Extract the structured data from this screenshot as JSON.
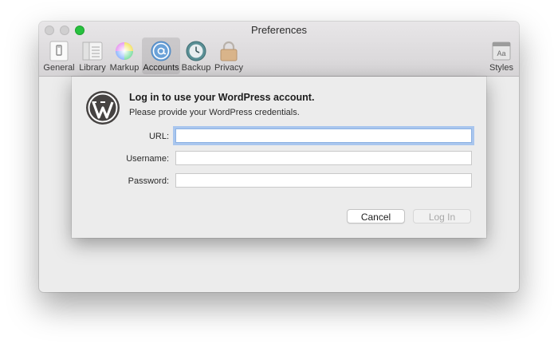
{
  "window": {
    "title": "Preferences"
  },
  "toolbar": {
    "items": [
      {
        "label": "General",
        "icon": "general-icon"
      },
      {
        "label": "Library",
        "icon": "library-icon"
      },
      {
        "label": "Markup",
        "icon": "markup-color-wheel-icon"
      },
      {
        "label": "Accounts",
        "icon": "at-sign-icon",
        "selected": true
      },
      {
        "label": "Backup",
        "icon": "time-machine-icon"
      },
      {
        "label": "Privacy",
        "icon": "lock-icon"
      },
      {
        "label": "Styles",
        "icon": "styles-icon"
      }
    ]
  },
  "sheet": {
    "logo": "wordpress-logo-icon",
    "title": "Log in to use your WordPress account.",
    "subtitle": "Please provide your WordPress credentials.",
    "fields": {
      "url": {
        "label": "URL:",
        "value": ""
      },
      "username": {
        "label": "Username:",
        "value": ""
      },
      "password": {
        "label": "Password:",
        "value": ""
      }
    },
    "buttons": {
      "cancel": "Cancel",
      "login": "Log In"
    }
  },
  "colors": {
    "focus_ring": "#a9c6ee",
    "zoom_button": "#27c13f",
    "window_bg": "#ececec"
  }
}
